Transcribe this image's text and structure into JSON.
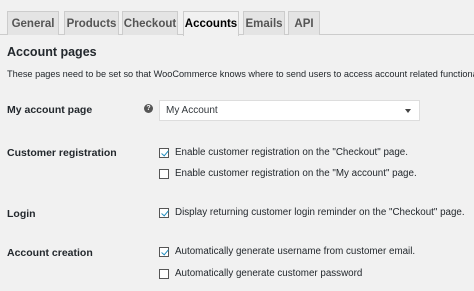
{
  "tabs": [
    {
      "label": "General",
      "active": false
    },
    {
      "label": "Products",
      "active": false
    },
    {
      "label": "Checkout",
      "active": false
    },
    {
      "label": "Accounts",
      "active": true
    },
    {
      "label": "Emails",
      "active": false
    },
    {
      "label": "API",
      "active": false
    }
  ],
  "section": {
    "title": "Account pages",
    "description": "These pages need to be set so that WooCommerce knows where to send users to access account related functionality."
  },
  "my_account_page": {
    "label": "My account page",
    "help_icon": "?",
    "selected": "My Account"
  },
  "customer_registration": {
    "label": "Customer registration",
    "options": [
      {
        "label": "Enable customer registration on the \"Checkout\" page.",
        "checked": true
      },
      {
        "label": "Enable customer registration on the \"My account\" page.",
        "checked": false
      }
    ]
  },
  "login": {
    "label": "Login",
    "options": [
      {
        "label": "Display returning customer login reminder on the \"Checkout\" page.",
        "checked": true
      }
    ]
  },
  "account_creation": {
    "label": "Account creation",
    "options": [
      {
        "label": "Automatically generate username from customer email.",
        "checked": true
      },
      {
        "label": "Automatically generate customer password",
        "checked": false
      }
    ]
  },
  "colors": {
    "background": "#f1f1f1",
    "tab_inactive": "#e4e4e4",
    "checkmark": "#1e8cbe"
  }
}
